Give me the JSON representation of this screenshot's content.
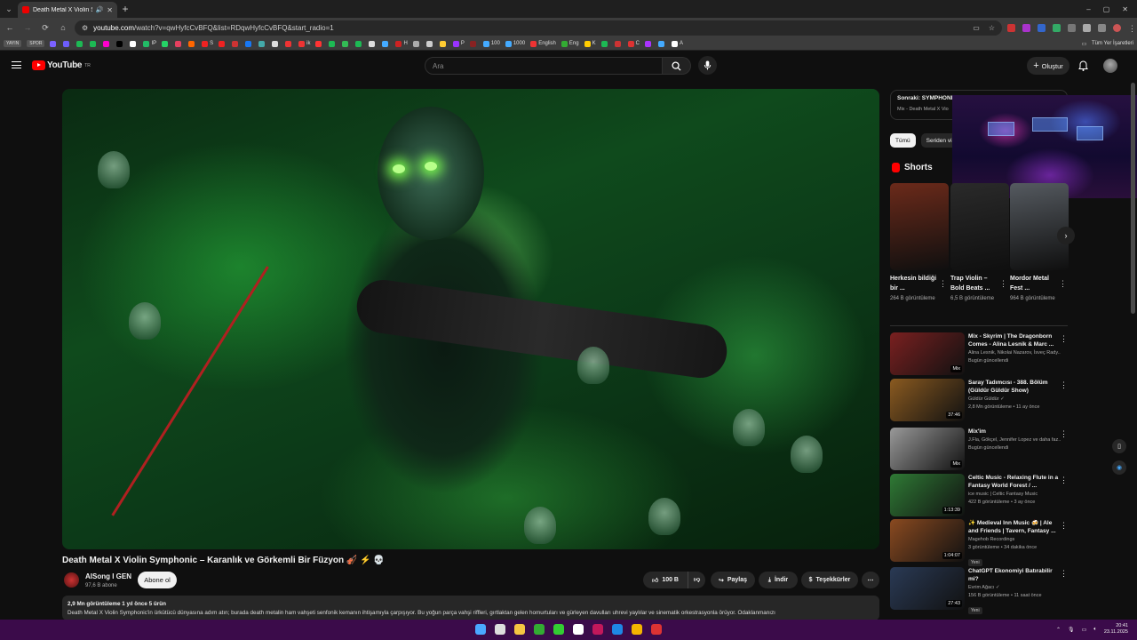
{
  "browser": {
    "tab_title": "Death Metal X Violin Symp",
    "tab_close": "✕",
    "new_tab": "+",
    "url_host": "youtube.com",
    "url_path": "/watch?v=qwHyfcCvBFQ&list=RDqwHyfcCvBFQ&start_radio=1",
    "window_controls": [
      "–",
      "▢",
      "✕"
    ]
  },
  "bookmarks": {
    "tags": [
      "YAYIN",
      "SPOR"
    ],
    "items": [
      {
        "label": "",
        "color": "#7b61ff"
      },
      {
        "label": "",
        "color": "#6d5dfc"
      },
      {
        "label": "",
        "color": "#1db954"
      },
      {
        "label": "",
        "color": "#1db954"
      },
      {
        "label": "",
        "color": "#f0c"
      },
      {
        "label": "",
        "color": "#000"
      },
      {
        "label": "",
        "color": "#fff"
      },
      {
        "label": "IP",
        "color": "#2b6"
      },
      {
        "label": "",
        "color": "#25d366"
      },
      {
        "label": "",
        "color": "#e4405f"
      },
      {
        "label": "",
        "color": "#f60"
      },
      {
        "label": "S",
        "color": "#e22"
      },
      {
        "label": "",
        "color": "#e22"
      },
      {
        "label": "",
        "color": "#c33"
      },
      {
        "label": "",
        "color": "#1877f2"
      },
      {
        "label": "",
        "color": "#4aa"
      },
      {
        "label": "",
        "color": "#ddd"
      },
      {
        "label": "",
        "color": "#e33"
      },
      {
        "label": "ik",
        "color": "#e33"
      },
      {
        "label": "",
        "color": "#f33"
      },
      {
        "label": "",
        "color": "#1db954"
      },
      {
        "label": "",
        "color": "#3b5"
      },
      {
        "label": "",
        "color": "#1db954"
      },
      {
        "label": "",
        "color": "#ddd"
      },
      {
        "label": "",
        "color": "#4af"
      },
      {
        "label": "H",
        "color": "#c22"
      },
      {
        "label": "",
        "color": "#aaa"
      },
      {
        "label": "",
        "color": "#ccc"
      },
      {
        "label": "",
        "color": "#fc3"
      },
      {
        "label": "P",
        "color": "#93f"
      },
      {
        "label": "",
        "color": "#822"
      },
      {
        "label": "100",
        "color": "#4af"
      },
      {
        "label": "1000",
        "color": "#4af"
      },
      {
        "label": "English",
        "color": "#e33"
      },
      {
        "label": "Eng",
        "color": "#3a3"
      },
      {
        "label": "K",
        "color": "#fc0"
      },
      {
        "label": "",
        "color": "#1db954"
      },
      {
        "label": "",
        "color": "#c33"
      },
      {
        "label": "C",
        "color": "#d33"
      },
      {
        "label": "",
        "color": "#a3f"
      },
      {
        "label": "",
        "color": "#4af"
      },
      {
        "label": "A",
        "color": "#fff"
      }
    ],
    "right_label": "Tüm Yer İşaretleri"
  },
  "youtube": {
    "logo_text": "YouTube",
    "logo_region": "TR",
    "search_placeholder": "Ara",
    "create_label": "Oluştur"
  },
  "video": {
    "title": "Death Metal X Violin Symphonic – Karanlık ve Görkemli Bir Füzyon 🎻 ⚡ 💀",
    "channel": "AISong I GEN",
    "subscribers": "97,6 B abone",
    "subscribe_label": "Abone ol",
    "likes": "100 B",
    "share_label": "Paylaş",
    "download_label": "İndir",
    "thanks_label": "Teşekkürler",
    "more_label": "⋯",
    "desc_meta": "2,9 Mn görüntüleme  1 yıl önce  5 ürün",
    "desc_body": "Death Metal X Violin Symphonic'in ürkütücü dünyasına adım atın; burada death metalin ham vahşeti senfonik kemanın ihtişamıyla çarpışıyor. Bu yoğun parça vahşi riffleri, gırtlaktan gelen homurtuları ve gürleyen davulları uhrevi yaylılar ve sinematik orkestrasyonla örüyor. Odaklanmanızı"
  },
  "sidebar": {
    "upnext_title": "Sonraki: SYMPHONIC",
    "upnext_sub": "Mix - Death Metal X Vio",
    "chips": [
      "Tümü",
      "Seriden vi"
    ],
    "shorts_header": "Shorts",
    "shorts": [
      {
        "title": "Herkesin bildiği bir ...",
        "views": "264 B görüntüleme",
        "color": "#6b2a1a"
      },
      {
        "title": "Trap Violin – Bold Beats ...",
        "views": "6,5 B görüntüleme",
        "color": "#2a2a2a"
      },
      {
        "title": "Mordor Metal Fest ...",
        "views": "964 B görüntüleme",
        "color": "#555a60"
      }
    ],
    "recommendations": [
      {
        "title": "Mix - Skyrim | The Dragonborn Comes - Alina Lesnik & Marc ...",
        "channel": "Alina Lesnik, Nikolai Nazarov, İsveç Rady...",
        "meta": "Bugün güncellendi",
        "badge": "Mix",
        "new": "",
        "color": "#7a2020"
      },
      {
        "title": "Saray Tadımcısı - 388. Bölüm (Güldür Güldür Show)",
        "channel": "Güldür Güldür ✓",
        "meta": "2,8 Mn görüntüleme • 11 ay önce",
        "badge": "37:46",
        "new": "",
        "color": "#8a5a20"
      },
      {
        "title": "Mix'im",
        "channel": "J.Fla, Gökçel, Jennifer Lopez ve daha faz...",
        "meta": "Bugün güncellendi",
        "badge": "Mix",
        "new": "",
        "color": "#999"
      },
      {
        "title": "Celtic Music - Relaxing Flute in a Fantasy World Forest / ...",
        "channel": "ice music | Celtic Fantasy Music",
        "meta": "422 B görüntüleme • 3 ay önce",
        "badge": "1:13:39",
        "new": "",
        "color": "#2f7a35"
      },
      {
        "title": "✨ Medieval Inn Music 🍻 | Ale and Friends | Tavern, Fantasy ...",
        "channel": "Magehob Recordings",
        "meta": "3 görüntüleme • 34 dakika önce",
        "badge": "1:04:07",
        "new": "Yeni",
        "color": "#8a4a20"
      },
      {
        "title": "ChatGPT Ekonomiyi Batırabilir mi?",
        "channel": "Evrim Ağacı ✓",
        "meta": "156 B görüntüleme • 11 saat önce",
        "badge": "27:43",
        "new": "Yeni",
        "color": "#2a3a55"
      }
    ]
  },
  "taskbar": {
    "icons": [
      {
        "name": "windows-start-icon",
        "color": "#4aa8ff"
      },
      {
        "name": "task-view-icon",
        "color": "#ddd"
      },
      {
        "name": "file-explorer-icon",
        "color": "#f5c542"
      },
      {
        "name": "xbox-icon",
        "color": "#3a3"
      },
      {
        "name": "pycharm-icon",
        "color": "#3c3"
      },
      {
        "name": "app-icon",
        "color": "#fff"
      },
      {
        "name": "app-icon-2",
        "color": "#c2185b"
      },
      {
        "name": "app-icon-3",
        "color": "#1e88e5"
      },
      {
        "name": "chrome-icon",
        "color": "#f4b400"
      },
      {
        "name": "app-icon-4",
        "color": "#d33"
      }
    ],
    "time": "20:41",
    "date": "23.11.2025"
  }
}
